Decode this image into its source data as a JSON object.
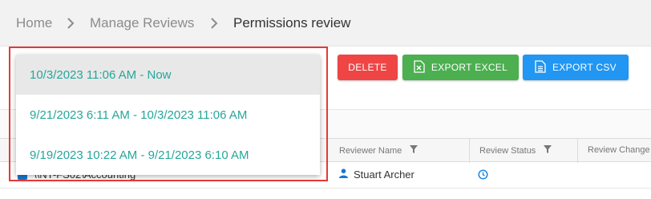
{
  "breadcrumb": {
    "home": "Home",
    "manage_reviews": "Manage Reviews",
    "current": "Permissions review"
  },
  "toolbar": {
    "delete_label": "DELETE",
    "export_excel_label": "EXPORT EXCEL",
    "export_csv_label": "EXPORT CSV"
  },
  "dropdown": {
    "items": [
      {
        "label": "10/3/2023 11:06 AM - Now",
        "selected": true
      },
      {
        "label": "9/21/2023 6:11 AM - 10/3/2023 11:06 AM",
        "selected": false
      },
      {
        "label": "9/19/2023 10:22 AM - 9/21/2023 6:10 AM",
        "selected": false
      }
    ]
  },
  "table": {
    "columns": {
      "reviewer_name": "Reviewer Name",
      "review_status": "Review Status",
      "review_change": "Review Change"
    },
    "rows": [
      {
        "path": "\\\\NT-FS02\\Accounting",
        "reviewer": "Stuart Archer",
        "status_icon": "clock-icon"
      }
    ]
  },
  "colors": {
    "accent_teal": "#26a69a",
    "delete_red": "#ef4545",
    "excel_green": "#4caf50",
    "csv_blue": "#2196f3",
    "highlight_red": "#e53935"
  },
  "icons": {
    "breadcrumb_separator": "chevron-right-icon",
    "excel": "excel-file-icon",
    "csv": "csv-file-icon",
    "filter": "filter-icon",
    "user": "user-icon",
    "status": "clock-icon"
  }
}
